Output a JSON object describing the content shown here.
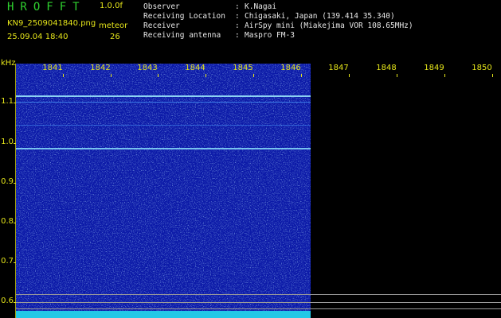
{
  "header": {
    "app_title": "HROFFT",
    "version": "1.0.0f",
    "filename": "KN9_2509041840.png",
    "datetime": "25.09.04 18:40",
    "meteor_label": "meteor",
    "meteor_count": "26"
  },
  "info": [
    {
      "key": "Observer",
      "sep": ":",
      "value": "K.Nagai"
    },
    {
      "key": "Receiving Location",
      "sep": ":",
      "value": "Chigasaki, Japan (139.414 35.340)"
    },
    {
      "key": "Receiver",
      "sep": ":",
      "value": "AirSpy mini (Miakejima VOR 108.65MHz)"
    },
    {
      "key": "Receiving antenna",
      "sep": ":",
      "value": "Maspro FM-3"
    }
  ],
  "axes": {
    "y_unit": "kHz",
    "y_ticks": [
      "1.1",
      "1.0",
      "0.9",
      "0.8",
      "0.7",
      "0.6"
    ],
    "x_ticks": [
      "1841",
      "1842",
      "1843",
      "1844",
      "1845",
      "1846",
      "1847",
      "1848",
      "1849",
      "1850"
    ]
  },
  "colors": {
    "background": "#000000",
    "label": "#e6e61a",
    "title": "#2fd12f",
    "spectrogram_base": "#0c1aa8",
    "signal_line": "#8fe8ff",
    "bottom_band": "#23c8e6"
  }
}
